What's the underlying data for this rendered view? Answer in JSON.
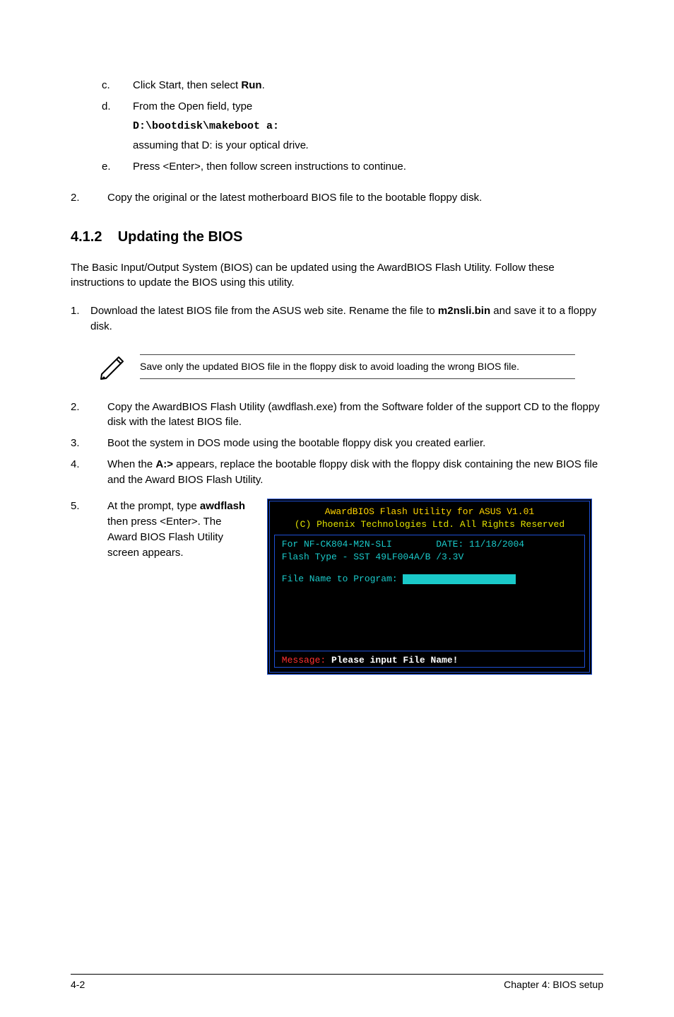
{
  "steps_abc": {
    "c": {
      "label": "c.",
      "text_prefix": "Click Start, then select ",
      "bold": "Run",
      "text_suffix": "."
    },
    "d": {
      "label": "d.",
      "line1": "From the Open field, type",
      "code": "D:\\bootdisk\\makeboot a:",
      "line2_prefix": "assuming that D: is your optical drive",
      "line2_suffix_italic": "."
    },
    "e": {
      "label": "e.",
      "text": "Press <Enter>, then follow screen instructions to continue."
    }
  },
  "step2": {
    "label": "2.",
    "text": "Copy the original or the latest motherboard BIOS file to the bootable floppy disk."
  },
  "section": {
    "number": "4.1.2",
    "title": "Updating the BIOS"
  },
  "paragraph1": "The Basic Input/Output System (BIOS) can be updated using the AwardBIOS Flash Utility. Follow these instructions to update the BIOS using this utility.",
  "step1b": {
    "label": "1.",
    "prefix": "Download the latest BIOS file from the ASUS web site. Rename the file to ",
    "bold": "m2nsli.bin",
    "suffix": " and save it to a floppy disk."
  },
  "note": "Save only the updated BIOS file in the floppy disk to avoid loading the wrong BIOS file.",
  "post_steps": {
    "s2": {
      "label": "2.",
      "text": "Copy the AwardBIOS Flash Utility (awdflash.exe) from the Software folder of the support CD to the floppy disk with the latest BIOS file."
    },
    "s3": {
      "label": "3.",
      "text": "Boot the system in DOS mode using the bootable floppy disk you created earlier."
    },
    "s4": {
      "label": "4.",
      "prefix": "When the ",
      "bold": "A:>",
      "suffix": " appears, replace the bootable floppy disk with the floppy disk containing the new BIOS file and the Award BIOS Flash Utility."
    },
    "s5": {
      "label": "5.",
      "prefix": "At the prompt, type ",
      "bold": "awdflash",
      "suffix": " then press <Enter>. The Award BIOS Flash Utility screen appears."
    }
  },
  "terminal": {
    "title": "AwardBIOS Flash Utility for ASUS V1.01",
    "sub": "(C) Phoenix Technologies Ltd. All Rights Reserved",
    "for_line_left": " For NF-CK804-M2N-SLI",
    "for_line_right": "DATE: 11/18/2004",
    "flash_line": " Flash Type - SST 49LF004A/B /3.3V",
    "file_prompt": " File Name to Program:",
    "msg_label": " Message:",
    "msg_text": " Please input File Name!"
  },
  "footer": {
    "left": "4-2",
    "right": "Chapter 4: BIOS setup"
  }
}
